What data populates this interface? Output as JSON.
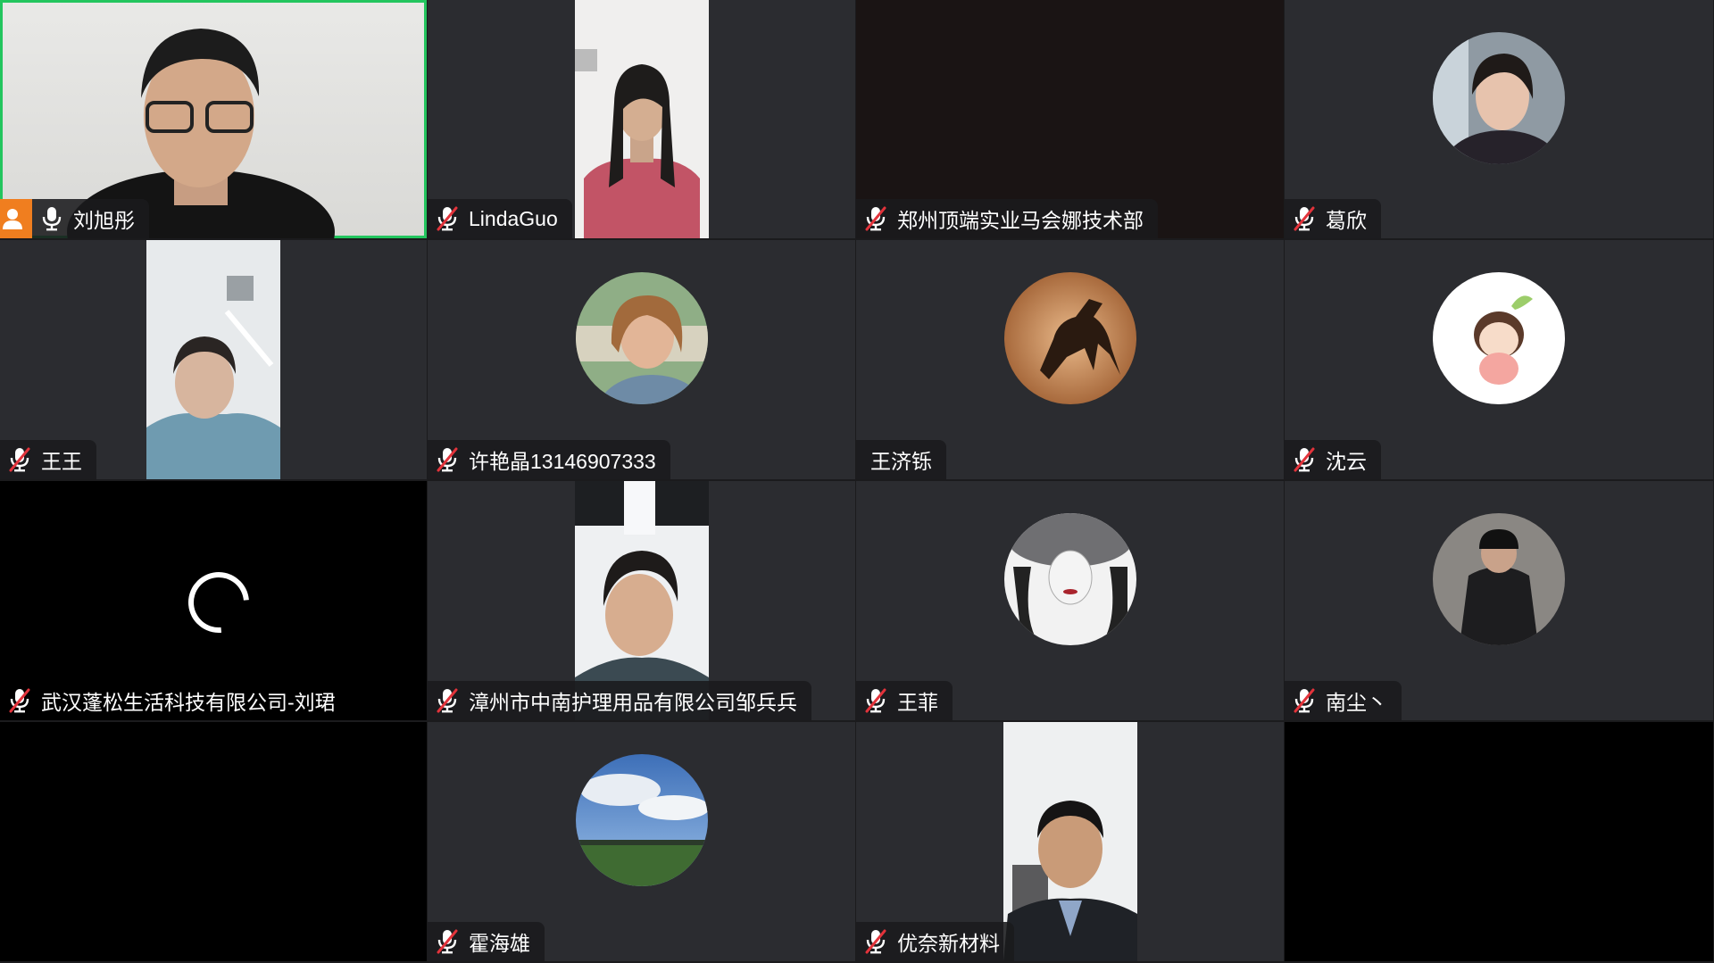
{
  "participants": [
    {
      "name": "刘旭彤",
      "muted": false,
      "host": true,
      "active": true
    },
    {
      "name": "LindaGuo",
      "muted": true
    },
    {
      "name": "郑州顶端实业马会娜技术部",
      "muted": true
    },
    {
      "name": "葛欣",
      "muted": true
    },
    {
      "name": "王王",
      "muted": true
    },
    {
      "name": "许艳晶13146907333",
      "muted": true
    },
    {
      "name": "王济铄",
      "muted": false
    },
    {
      "name": "沈云",
      "muted": true
    },
    {
      "name": "武汉蓬松生活科技有限公司-刘珺",
      "muted": true,
      "loading": true
    },
    {
      "name": "漳州市中南护理用品有限公司邹兵兵",
      "muted": true
    },
    {
      "name": "王菲",
      "muted": true
    },
    {
      "name": "南尘丶",
      "muted": true
    },
    {
      "name": "霍海雄",
      "muted": true
    },
    {
      "name": "优奈新材料",
      "muted": true
    }
  ],
  "colors": {
    "tile_bg": "#2b2c30",
    "active_border": "#23c55e",
    "muted_icon": "#e2333b",
    "host_badge": "#f07e1f"
  }
}
